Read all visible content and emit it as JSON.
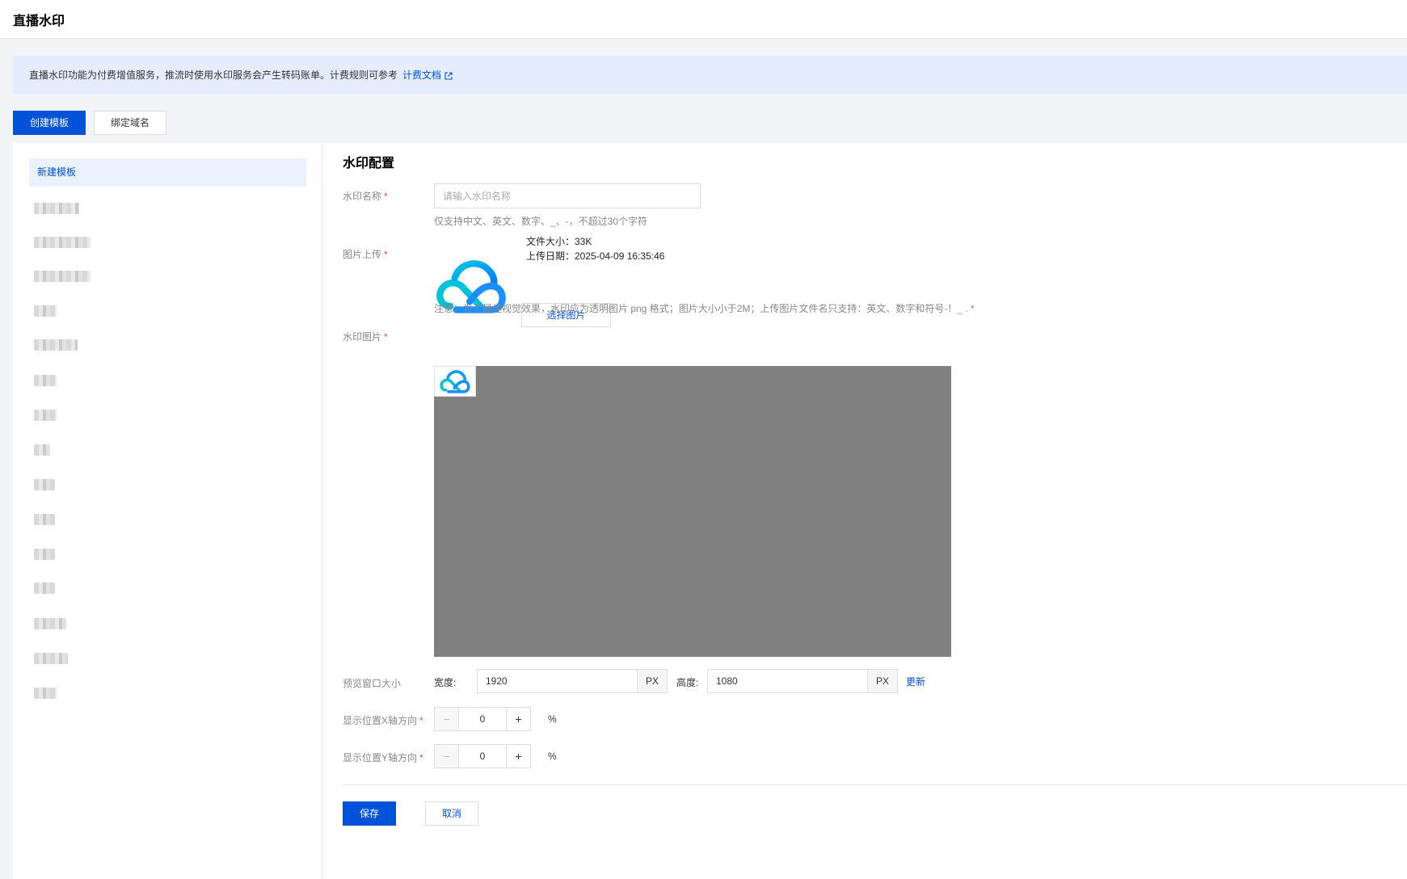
{
  "header": {
    "title": "直播水印"
  },
  "notice": {
    "text": "直播水印功能为付费增值服务，推流时使用水印服务会产生转码账单。计费规则可参考",
    "link_text": "计费文档"
  },
  "toolbar": {
    "create_label": "创建模板",
    "bind_label": "绑定域名"
  },
  "sidebar": {
    "active_item": "新建模板"
  },
  "form": {
    "section_title": "水印配置",
    "name_label": "水印名称",
    "name_placeholder": "请输入水印名称",
    "name_value": "",
    "name_hint": "仅支持中文、英文、数字、_、-，不超过30个字符",
    "upload_label": "图片上传",
    "file_size": "文件大小：33K",
    "upload_date": "上传日期：2025-04-09 16:35:46",
    "choose_label": "选择图片",
    "upload_note": "注意：为了最佳视觉效果，水印应为透明图片 png 格式；图片大小小于2M；上传图片文件名只支持：英文、数字和符号-！_ . *",
    "image_label": "水印图片",
    "preview_size_label": "预览窗口大小",
    "width_label": "宽度:",
    "width_value": "1920",
    "height_label": "高度:",
    "height_value": "1080",
    "unit": "PX",
    "refresh_label": "更新",
    "x_label": "显示位置X轴方向",
    "x_value": "0",
    "y_label": "显示位置Y轴方向",
    "y_value": "0",
    "percent": "%",
    "dec_symbol": "−",
    "inc_symbol": "+",
    "required_mark": "*"
  },
  "footer": {
    "save_label": "保存",
    "cancel_label": "取消"
  },
  "colors": {
    "primary": "#0052d9",
    "notice_bg": "#e5edfc",
    "preview_bg": "#808080",
    "required": "#e34d59"
  },
  "icons": {
    "external_link": "external-link-icon",
    "cloud_logo": "cloud-logo-icon"
  }
}
